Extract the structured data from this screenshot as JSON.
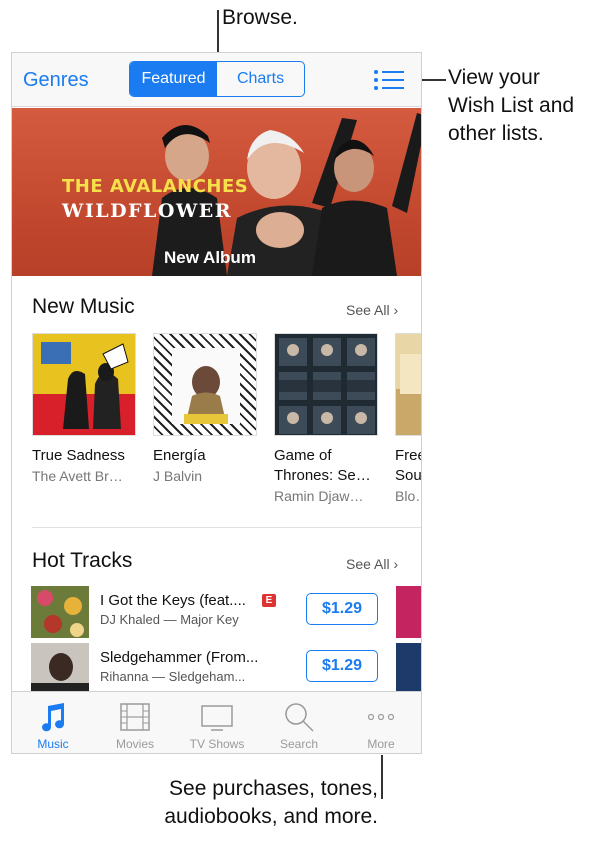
{
  "callouts": {
    "browse": "Browse.",
    "wishlist": "View your Wish List and other lists.",
    "more": "See purchases, tones, audiobooks, and more."
  },
  "nav": {
    "genres": "Genres",
    "segments": [
      "Featured",
      "Charts"
    ],
    "active_segment": "Featured",
    "list_icon": "list-icon",
    "accent": "#1a7cf0"
  },
  "hero": {
    "title_line1": "THE AVALANCHES",
    "title_line2": "WILDFLOWER",
    "caption": "New Album"
  },
  "new_music": {
    "title": "New Music",
    "see_all": "See All",
    "albums": [
      {
        "name": "True Sadness",
        "artist": "The Avett Br…"
      },
      {
        "name": "Energía",
        "artist": "J Balvin"
      },
      {
        "name": "Game of Thrones: Se…",
        "artist": "Ramin Djaw…"
      },
      {
        "name": "Free Sou…",
        "artist": "Blo…"
      }
    ]
  },
  "hot_tracks": {
    "title": "Hot Tracks",
    "see_all": "See All",
    "tracks": [
      {
        "title": "I Got the Keys (feat....",
        "subtitle": "DJ Khaled — Major Key",
        "explicit": "E",
        "price": "$1.29"
      },
      {
        "title": "Sledgehammer (From...",
        "subtitle": "Rihanna — Sledgeham...",
        "price": "$1.29"
      }
    ]
  },
  "tabbar": {
    "active": "Music",
    "tabs": [
      {
        "label": "Music",
        "icon": "music-note-icon"
      },
      {
        "label": "Movies",
        "icon": "film-icon"
      },
      {
        "label": "TV Shows",
        "icon": "tv-icon"
      },
      {
        "label": "Search",
        "icon": "search-icon"
      },
      {
        "label": "More",
        "icon": "more-icon"
      }
    ]
  }
}
